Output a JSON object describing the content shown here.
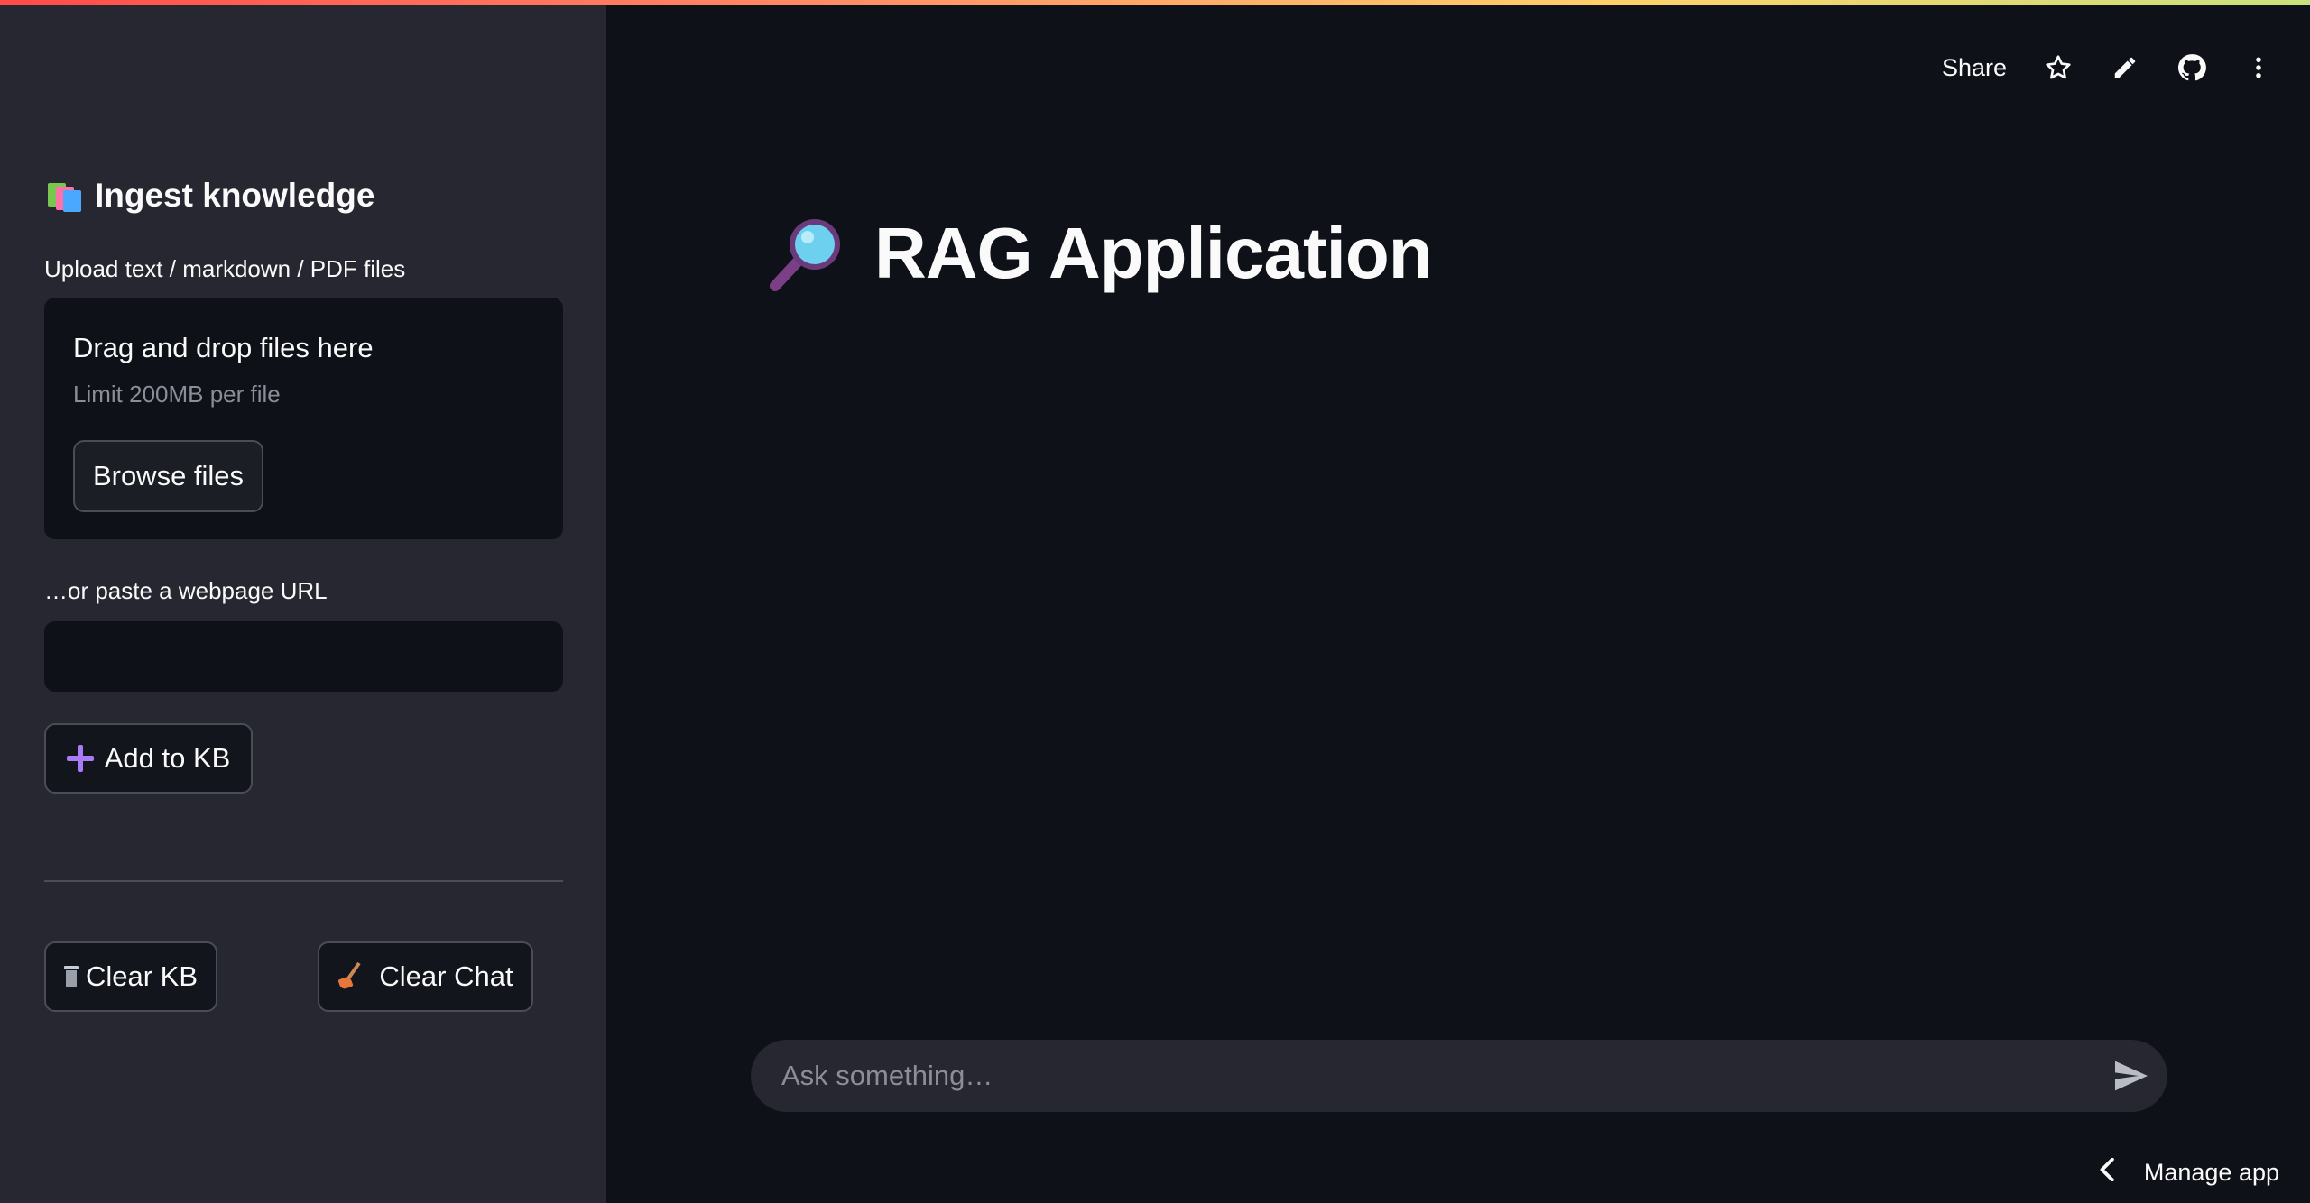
{
  "sidebar": {
    "header_title": "Ingest knowledge",
    "header_icon": "books-icon",
    "upload_label": "Upload text / markdown / PDF files",
    "dropzone": {
      "title": "Drag and drop files here",
      "limit": "Limit 200MB per file",
      "browse_label": "Browse files"
    },
    "url_label": "…or paste a webpage URL",
    "url_value": "",
    "add_label": "Add to KB",
    "clear_kb_label": "Clear KB",
    "clear_chat_label": "Clear Chat"
  },
  "toolbar": {
    "share_label": "Share",
    "icons": [
      "star-icon",
      "pencil-icon",
      "github-icon",
      "kebab-menu-icon"
    ]
  },
  "main": {
    "title": "RAG Application",
    "title_icon": "magnifying-glass-icon"
  },
  "chat": {
    "placeholder": "Ask something…"
  },
  "footer": {
    "manage_label": "Manage app"
  },
  "colors": {
    "background": "#0e1117",
    "sidebar": "#262730",
    "accent": "#ff4b4b"
  }
}
